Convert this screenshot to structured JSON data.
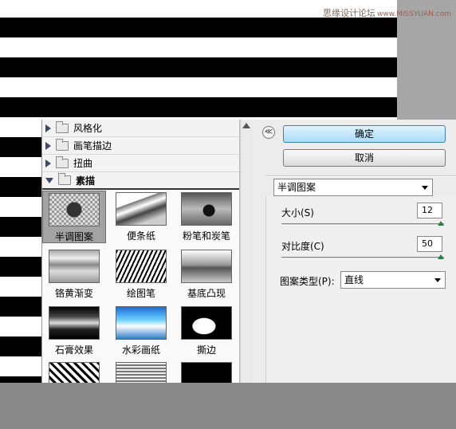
{
  "watermark": {
    "text": "思缘设计论坛",
    "url": "www.MISSYUAN.com"
  },
  "gallery": {
    "categories": [
      {
        "label": "风格化",
        "expanded": false
      },
      {
        "label": "画笔描边",
        "expanded": false
      },
      {
        "label": "扭曲",
        "expanded": false
      },
      {
        "label": "素描",
        "expanded": true
      }
    ],
    "filters": [
      {
        "label": "半调图案",
        "selected": true
      },
      {
        "label": "便条纸"
      },
      {
        "label": "粉笔和炭笔"
      },
      {
        "label": "铬黄渐变"
      },
      {
        "label": "绘图笔"
      },
      {
        "label": "基底凸现"
      },
      {
        "label": "石膏效果"
      },
      {
        "label": "水彩画纸"
      },
      {
        "label": "撕边"
      }
    ]
  },
  "panel": {
    "collapse_symbol": "≪",
    "ok_label": "确定",
    "cancel_label": "取消",
    "filter_select_value": "半调图案",
    "size_label": "大小(S)",
    "size_value": "12",
    "size_level": 1.0,
    "contrast_label": "对比度(C)",
    "contrast_value": "50",
    "contrast_level": 1.0,
    "pattern_type_label": "图案类型(P):",
    "pattern_type_value": "直线"
  }
}
